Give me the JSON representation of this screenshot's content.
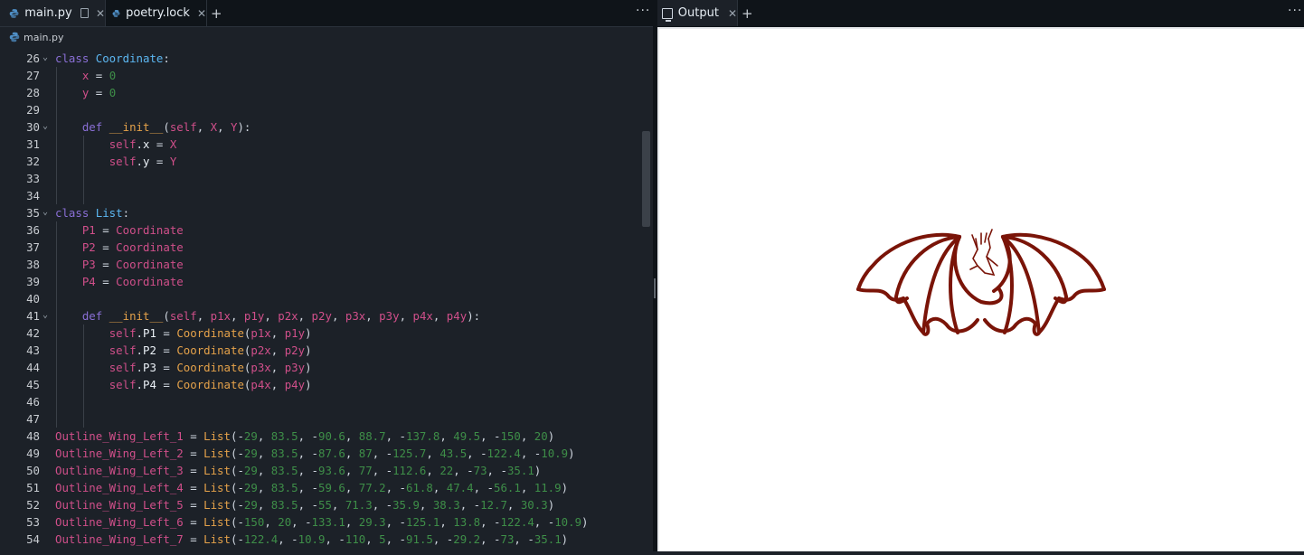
{
  "tabs": [
    {
      "label": "main.py",
      "icon": "python-icon",
      "active": true
    },
    {
      "label": "poetry.lock",
      "icon": "python-icon",
      "active": false
    }
  ],
  "breadcrumb": "main.py",
  "output_tab": {
    "label": "Output",
    "icon": "monitor-icon"
  },
  "colors": {
    "editor_bg": "#1c2128",
    "tabbar_bg": "#0f1419",
    "dragon_stroke": "#7a1408"
  },
  "code_lines": [
    {
      "n": "26",
      "fold": true,
      "toks": [
        [
          "kw",
          "class "
        ],
        [
          "cls",
          "Coordinate"
        ],
        [
          "pun",
          ":"
        ]
      ]
    },
    {
      "n": "27",
      "fold": false,
      "toks": [
        [
          "pun",
          "    "
        ],
        [
          "var",
          "x"
        ],
        [
          "pun",
          " = "
        ],
        [
          "num",
          "0"
        ]
      ]
    },
    {
      "n": "28",
      "fold": false,
      "toks": [
        [
          "pun",
          "    "
        ],
        [
          "var",
          "y"
        ],
        [
          "pun",
          " = "
        ],
        [
          "num",
          "0"
        ]
      ]
    },
    {
      "n": "29",
      "fold": false,
      "toks": []
    },
    {
      "n": "30",
      "fold": true,
      "toks": [
        [
          "pun",
          "    "
        ],
        [
          "kw",
          "def "
        ],
        [
          "fn",
          "__init__"
        ],
        [
          "pun",
          "("
        ],
        [
          "slf",
          "self"
        ],
        [
          "pun",
          ", "
        ],
        [
          "var",
          "X"
        ],
        [
          "pun",
          ", "
        ],
        [
          "var",
          "Y"
        ],
        [
          "pun",
          "):"
        ]
      ]
    },
    {
      "n": "31",
      "fold": false,
      "toks": [
        [
          "pun",
          "        "
        ],
        [
          "slf",
          "self"
        ],
        [
          "pun",
          "."
        ],
        [
          "atr",
          "x"
        ],
        [
          "pun",
          " = "
        ],
        [
          "var",
          "X"
        ]
      ]
    },
    {
      "n": "32",
      "fold": false,
      "toks": [
        [
          "pun",
          "        "
        ],
        [
          "slf",
          "self"
        ],
        [
          "pun",
          "."
        ],
        [
          "atr",
          "y"
        ],
        [
          "pun",
          " = "
        ],
        [
          "var",
          "Y"
        ]
      ]
    },
    {
      "n": "33",
      "fold": false,
      "toks": []
    },
    {
      "n": "34",
      "fold": false,
      "toks": []
    },
    {
      "n": "35",
      "fold": true,
      "toks": [
        [
          "kw",
          "class "
        ],
        [
          "cls",
          "List"
        ],
        [
          "pun",
          ":"
        ]
      ]
    },
    {
      "n": "36",
      "fold": false,
      "toks": [
        [
          "pun",
          "    "
        ],
        [
          "var",
          "P1"
        ],
        [
          "pun",
          " = "
        ],
        [
          "var",
          "Coordinate"
        ]
      ]
    },
    {
      "n": "37",
      "fold": false,
      "toks": [
        [
          "pun",
          "    "
        ],
        [
          "var",
          "P2"
        ],
        [
          "pun",
          " = "
        ],
        [
          "var",
          "Coordinate"
        ]
      ]
    },
    {
      "n": "38",
      "fold": false,
      "toks": [
        [
          "pun",
          "    "
        ],
        [
          "var",
          "P3"
        ],
        [
          "pun",
          " = "
        ],
        [
          "var",
          "Coordinate"
        ]
      ]
    },
    {
      "n": "39",
      "fold": false,
      "toks": [
        [
          "pun",
          "    "
        ],
        [
          "var",
          "P4"
        ],
        [
          "pun",
          " = "
        ],
        [
          "var",
          "Coordinate"
        ]
      ]
    },
    {
      "n": "40",
      "fold": false,
      "toks": []
    },
    {
      "n": "41",
      "fold": true,
      "toks": [
        [
          "pun",
          "    "
        ],
        [
          "kw",
          "def "
        ],
        [
          "fn",
          "__init__"
        ],
        [
          "pun",
          "("
        ],
        [
          "slf",
          "self"
        ],
        [
          "pun",
          ", "
        ],
        [
          "var",
          "p1x"
        ],
        [
          "pun",
          ", "
        ],
        [
          "var",
          "p1y"
        ],
        [
          "pun",
          ", "
        ],
        [
          "var",
          "p2x"
        ],
        [
          "pun",
          ", "
        ],
        [
          "var",
          "p2y"
        ],
        [
          "pun",
          ", "
        ],
        [
          "var",
          "p3x"
        ],
        [
          "pun",
          ", "
        ],
        [
          "var",
          "p3y"
        ],
        [
          "pun",
          ", "
        ],
        [
          "var",
          "p4x"
        ],
        [
          "pun",
          ", "
        ],
        [
          "var",
          "p4y"
        ],
        [
          "pun",
          "):"
        ]
      ]
    },
    {
      "n": "42",
      "fold": false,
      "toks": [
        [
          "pun",
          "        "
        ],
        [
          "slf",
          "self"
        ],
        [
          "pun",
          "."
        ],
        [
          "atr",
          "P1"
        ],
        [
          "pun",
          " = "
        ],
        [
          "fn",
          "Coordinate"
        ],
        [
          "pun",
          "("
        ],
        [
          "var",
          "p1x"
        ],
        [
          "pun",
          ", "
        ],
        [
          "var",
          "p1y"
        ],
        [
          "pun",
          ")"
        ]
      ]
    },
    {
      "n": "43",
      "fold": false,
      "toks": [
        [
          "pun",
          "        "
        ],
        [
          "slf",
          "self"
        ],
        [
          "pun",
          "."
        ],
        [
          "atr",
          "P2"
        ],
        [
          "pun",
          " = "
        ],
        [
          "fn",
          "Coordinate"
        ],
        [
          "pun",
          "("
        ],
        [
          "var",
          "p2x"
        ],
        [
          "pun",
          ", "
        ],
        [
          "var",
          "p2y"
        ],
        [
          "pun",
          ")"
        ]
      ]
    },
    {
      "n": "44",
      "fold": false,
      "toks": [
        [
          "pun",
          "        "
        ],
        [
          "slf",
          "self"
        ],
        [
          "pun",
          "."
        ],
        [
          "atr",
          "P3"
        ],
        [
          "pun",
          " = "
        ],
        [
          "fn",
          "Coordinate"
        ],
        [
          "pun",
          "("
        ],
        [
          "var",
          "p3x"
        ],
        [
          "pun",
          ", "
        ],
        [
          "var",
          "p3y"
        ],
        [
          "pun",
          ")"
        ]
      ]
    },
    {
      "n": "45",
      "fold": false,
      "toks": [
        [
          "pun",
          "        "
        ],
        [
          "slf",
          "self"
        ],
        [
          "pun",
          "."
        ],
        [
          "atr",
          "P4"
        ],
        [
          "pun",
          " = "
        ],
        [
          "fn",
          "Coordinate"
        ],
        [
          "pun",
          "("
        ],
        [
          "var",
          "p4x"
        ],
        [
          "pun",
          ", "
        ],
        [
          "var",
          "p4y"
        ],
        [
          "pun",
          ")"
        ]
      ]
    },
    {
      "n": "46",
      "fold": false,
      "toks": []
    },
    {
      "n": "47",
      "fold": false,
      "toks": []
    },
    {
      "n": "48",
      "fold": false,
      "toks": [
        [
          "var",
          "Outline_Wing_Left_1"
        ],
        [
          "pun",
          " = "
        ],
        [
          "fn",
          "List"
        ],
        [
          "pun",
          "("
        ],
        [
          "pun",
          "-"
        ],
        [
          "num",
          "29"
        ],
        [
          "pun",
          ", "
        ],
        [
          "num",
          "83.5"
        ],
        [
          "pun",
          ", -"
        ],
        [
          "num",
          "90.6"
        ],
        [
          "pun",
          ", "
        ],
        [
          "num",
          "88.7"
        ],
        [
          "pun",
          ", -"
        ],
        [
          "num",
          "137.8"
        ],
        [
          "pun",
          ", "
        ],
        [
          "num",
          "49.5"
        ],
        [
          "pun",
          ", -"
        ],
        [
          "num",
          "150"
        ],
        [
          "pun",
          ", "
        ],
        [
          "num",
          "20"
        ],
        [
          "pun",
          ")"
        ]
      ]
    },
    {
      "n": "49",
      "fold": false,
      "toks": [
        [
          "var",
          "Outline_Wing_Left_2"
        ],
        [
          "pun",
          " = "
        ],
        [
          "fn",
          "List"
        ],
        [
          "pun",
          "("
        ],
        [
          "pun",
          "-"
        ],
        [
          "num",
          "29"
        ],
        [
          "pun",
          ", "
        ],
        [
          "num",
          "83.5"
        ],
        [
          "pun",
          ", -"
        ],
        [
          "num",
          "87.6"
        ],
        [
          "pun",
          ", "
        ],
        [
          "num",
          "87"
        ],
        [
          "pun",
          ", -"
        ],
        [
          "num",
          "125.7"
        ],
        [
          "pun",
          ", "
        ],
        [
          "num",
          "43.5"
        ],
        [
          "pun",
          ", -"
        ],
        [
          "num",
          "122.4"
        ],
        [
          "pun",
          ", -"
        ],
        [
          "num",
          "10.9"
        ],
        [
          "pun",
          ")"
        ]
      ]
    },
    {
      "n": "50",
      "fold": false,
      "toks": [
        [
          "var",
          "Outline_Wing_Left_3"
        ],
        [
          "pun",
          " = "
        ],
        [
          "fn",
          "List"
        ],
        [
          "pun",
          "("
        ],
        [
          "pun",
          "-"
        ],
        [
          "num",
          "29"
        ],
        [
          "pun",
          ", "
        ],
        [
          "num",
          "83.5"
        ],
        [
          "pun",
          ", -"
        ],
        [
          "num",
          "93.6"
        ],
        [
          "pun",
          ", "
        ],
        [
          "num",
          "77"
        ],
        [
          "pun",
          ", -"
        ],
        [
          "num",
          "112.6"
        ],
        [
          "pun",
          ", "
        ],
        [
          "num",
          "22"
        ],
        [
          "pun",
          ", -"
        ],
        [
          "num",
          "73"
        ],
        [
          "pun",
          ", -"
        ],
        [
          "num",
          "35.1"
        ],
        [
          "pun",
          ")"
        ]
      ]
    },
    {
      "n": "51",
      "fold": false,
      "toks": [
        [
          "var",
          "Outline_Wing_Left_4"
        ],
        [
          "pun",
          " = "
        ],
        [
          "fn",
          "List"
        ],
        [
          "pun",
          "("
        ],
        [
          "pun",
          "-"
        ],
        [
          "num",
          "29"
        ],
        [
          "pun",
          ", "
        ],
        [
          "num",
          "83.5"
        ],
        [
          "pun",
          ", -"
        ],
        [
          "num",
          "59.6"
        ],
        [
          "pun",
          ", "
        ],
        [
          "num",
          "77.2"
        ],
        [
          "pun",
          ", -"
        ],
        [
          "num",
          "61.8"
        ],
        [
          "pun",
          ", "
        ],
        [
          "num",
          "47.4"
        ],
        [
          "pun",
          ", -"
        ],
        [
          "num",
          "56.1"
        ],
        [
          "pun",
          ", "
        ],
        [
          "num",
          "11.9"
        ],
        [
          "pun",
          ")"
        ]
      ]
    },
    {
      "n": "52",
      "fold": false,
      "toks": [
        [
          "var",
          "Outline_Wing_Left_5"
        ],
        [
          "pun",
          " = "
        ],
        [
          "fn",
          "List"
        ],
        [
          "pun",
          "("
        ],
        [
          "pun",
          "-"
        ],
        [
          "num",
          "29"
        ],
        [
          "pun",
          ", "
        ],
        [
          "num",
          "83.5"
        ],
        [
          "pun",
          ", -"
        ],
        [
          "num",
          "55"
        ],
        [
          "pun",
          ", "
        ],
        [
          "num",
          "71.3"
        ],
        [
          "pun",
          ", -"
        ],
        [
          "num",
          "35.9"
        ],
        [
          "pun",
          ", "
        ],
        [
          "num",
          "38.3"
        ],
        [
          "pun",
          ", -"
        ],
        [
          "num",
          "12.7"
        ],
        [
          "pun",
          ", "
        ],
        [
          "num",
          "30.3"
        ],
        [
          "pun",
          ")"
        ]
      ]
    },
    {
      "n": "53",
      "fold": false,
      "toks": [
        [
          "var",
          "Outline_Wing_Left_6"
        ],
        [
          "pun",
          " = "
        ],
        [
          "fn",
          "List"
        ],
        [
          "pun",
          "("
        ],
        [
          "pun",
          "-"
        ],
        [
          "num",
          "150"
        ],
        [
          "pun",
          ", "
        ],
        [
          "num",
          "20"
        ],
        [
          "pun",
          ", -"
        ],
        [
          "num",
          "133.1"
        ],
        [
          "pun",
          ", "
        ],
        [
          "num",
          "29.3"
        ],
        [
          "pun",
          ", -"
        ],
        [
          "num",
          "125.1"
        ],
        [
          "pun",
          ", "
        ],
        [
          "num",
          "13.8"
        ],
        [
          "pun",
          ", -"
        ],
        [
          "num",
          "122.4"
        ],
        [
          "pun",
          ", -"
        ],
        [
          "num",
          "10.9"
        ],
        [
          "pun",
          ")"
        ]
      ]
    },
    {
      "n": "54",
      "fold": false,
      "toks": [
        [
          "var",
          "Outline_Wing_Left_7"
        ],
        [
          "pun",
          " = "
        ],
        [
          "fn",
          "List"
        ],
        [
          "pun",
          "("
        ],
        [
          "pun",
          "-"
        ],
        [
          "num",
          "122.4"
        ],
        [
          "pun",
          ", -"
        ],
        [
          "num",
          "10.9"
        ],
        [
          "pun",
          ", -"
        ],
        [
          "num",
          "110"
        ],
        [
          "pun",
          ", "
        ],
        [
          "num",
          "5"
        ],
        [
          "pun",
          ", -"
        ],
        [
          "num",
          "91.5"
        ],
        [
          "pun",
          ", -"
        ],
        [
          "num",
          "29.2"
        ],
        [
          "pun",
          ", -"
        ],
        [
          "num",
          "73"
        ],
        [
          "pun",
          ", -"
        ],
        [
          "num",
          "35.1"
        ],
        [
          "pun",
          ")"
        ]
      ]
    }
  ]
}
